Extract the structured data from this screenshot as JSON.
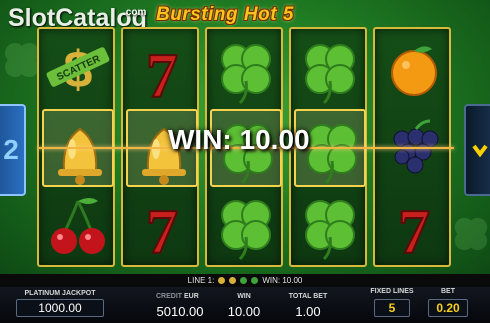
{
  "branding": {
    "logo_text": "SlotCatalog",
    "logo_suffix": ".com",
    "game_title": "Bursting Hot 5"
  },
  "reels": [
    [
      "scatter",
      "bell",
      "cherry"
    ],
    [
      "seven",
      "bell",
      "seven"
    ],
    [
      "clover",
      "clover",
      "clover"
    ],
    [
      "clover",
      "clover",
      "clover"
    ],
    [
      "orange",
      "grapes",
      "seven"
    ]
  ],
  "highlighted_cells": [
    "reel1-row2",
    "reel2-row2",
    "reel3-row2",
    "reel4-row2"
  ],
  "win_overlay": "WIN: 10.00",
  "side_tabs": {
    "left_number": "2",
    "right_arrow": "arrow-down-icon"
  },
  "line_info": {
    "prefix": "LINE 1:",
    "win": "WIN: 10.00"
  },
  "bottom": {
    "jackpot_label": "PLATINUM JACKPOT",
    "jackpot_value": "1000.00",
    "credit_label": "CREDIT",
    "currency": "EUR",
    "credit_value": "5010.00",
    "win_label": "WIN",
    "win_value": "10.00",
    "totalbet_label": "TOTAL BET",
    "totalbet_value": "1.00",
    "lines_label": "FIXED LINES",
    "lines_value": "5",
    "bet_label": "BET",
    "bet_value": "0.20"
  },
  "colors": {
    "gold": "#d8b93a",
    "win_line": "#f3b640",
    "accent_yellow": "#f7d21a",
    "side_blue": "#2a6fc2"
  }
}
